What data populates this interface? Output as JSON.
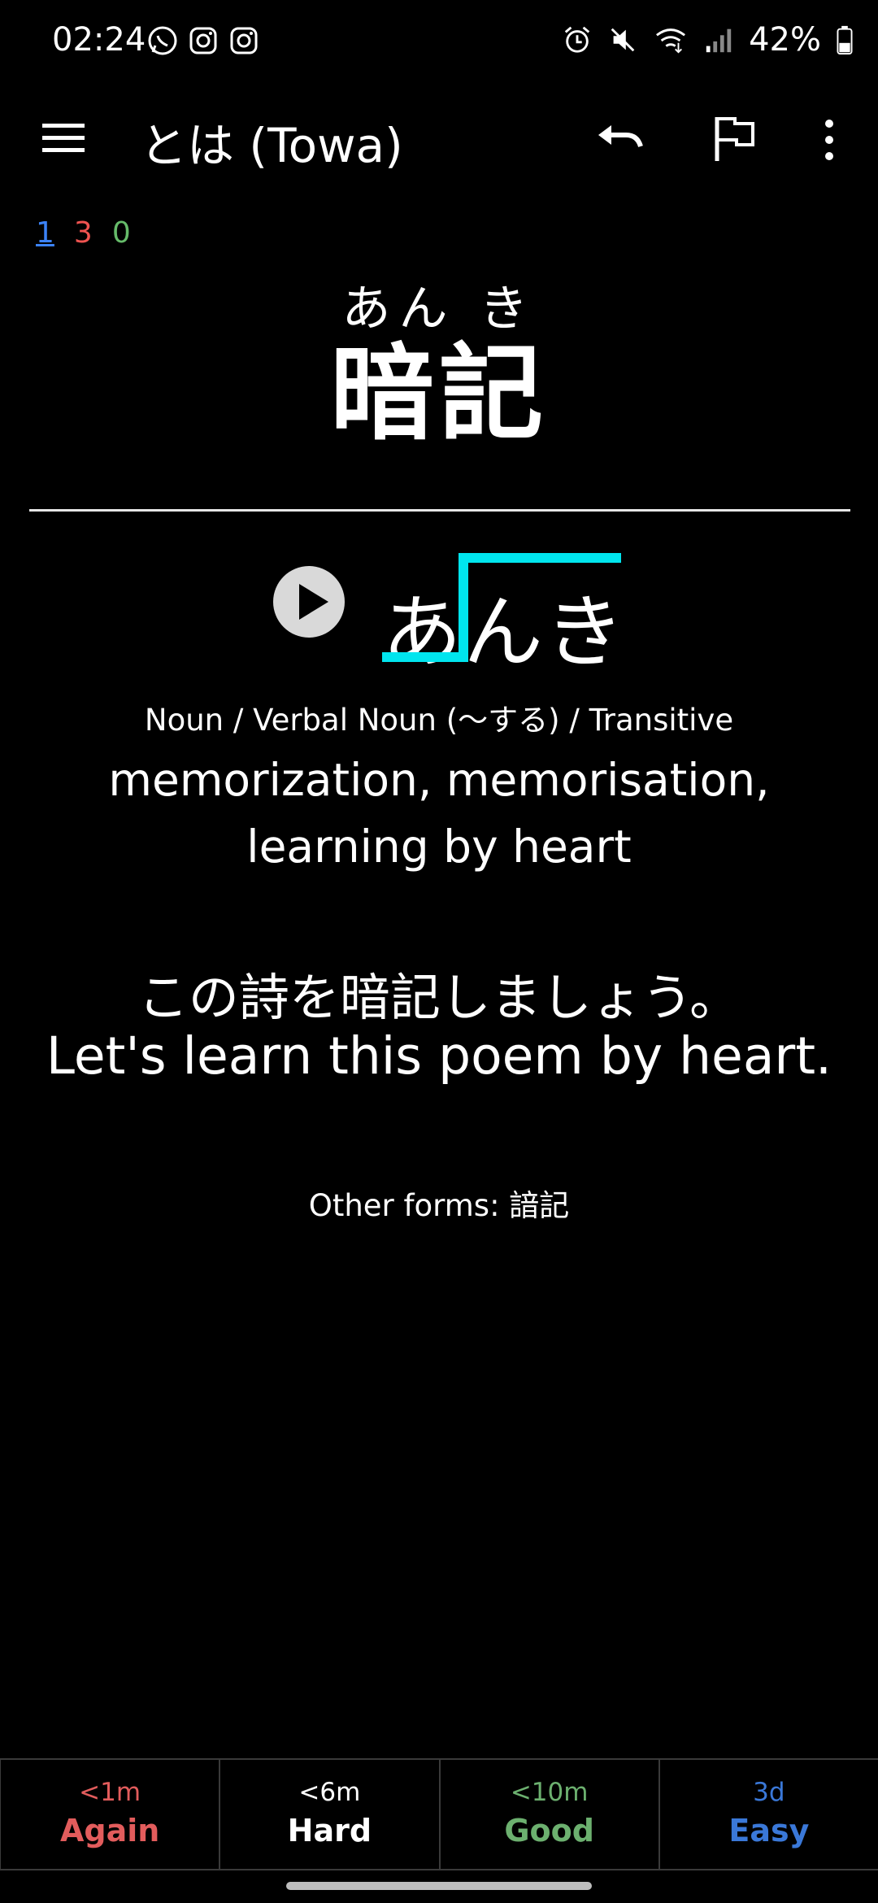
{
  "status_bar": {
    "time": "02:24",
    "left_icons": [
      "whatsapp-icon",
      "instagram-icon",
      "instagram-icon"
    ],
    "right_icons": [
      "alarm-icon",
      "mute-icon",
      "wifi-icon",
      "signal-icon",
      "battery-icon"
    ],
    "battery_text": "42%"
  },
  "app_bar": {
    "title": "とは (Towa)",
    "icons": [
      "menu-icon",
      "undo-icon",
      "flag-icon",
      "more-vert-icon"
    ]
  },
  "counts": {
    "new": "1",
    "learning": "3",
    "review": "0"
  },
  "card": {
    "furigana": "あん き",
    "kanji": "暗記",
    "reading": "あんき",
    "part_of_speech": "Noun / Verbal Noun (〜する) / Transitive",
    "meaning": "memorization, memorisation, learning by heart",
    "example_jp": "この詩を暗記しましょう。",
    "example_en": "Let's learn this poem by heart.",
    "other_forms": "Other forms: 諳記"
  },
  "answers": [
    {
      "time": "<1m",
      "label": "Again"
    },
    {
      "time": "<6m",
      "label": "Hard"
    },
    {
      "time": "<10m",
      "label": "Good"
    },
    {
      "time": "3d",
      "label": "Easy"
    }
  ],
  "colors": {
    "background": "#000000",
    "accent_pitch": "#00e5ee",
    "again": "#e25c5c",
    "good": "#6cb06f",
    "easy": "#3a78d8",
    "new_count": "#3b82f6",
    "learn_count": "#ef5350",
    "review_count": "#66bb6a"
  }
}
